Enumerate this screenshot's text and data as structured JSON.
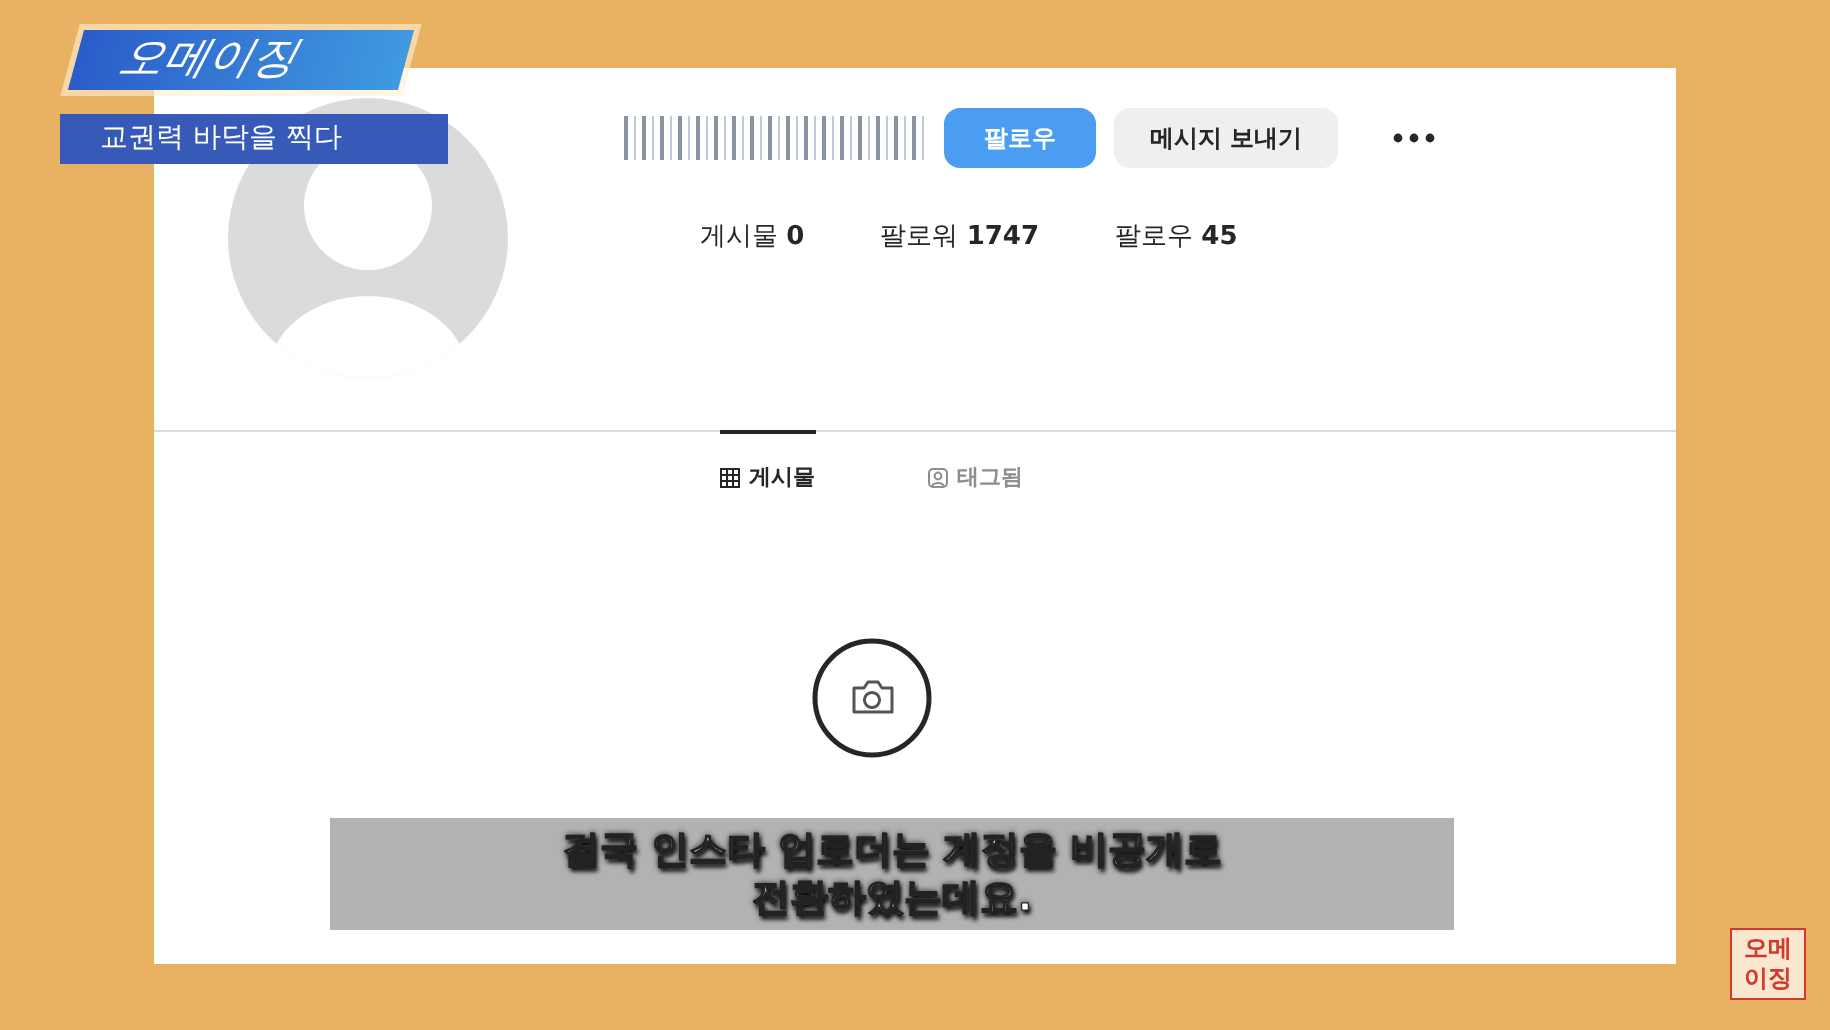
{
  "overlay": {
    "channel_logo": "오메이징",
    "program_title": "교권력 바닥을 찍다"
  },
  "profile": {
    "buttons": [
      {
        "label": "팔로우",
        "kind": "primary"
      },
      {
        "label": "메시지 보내기",
        "kind": "secondary"
      }
    ],
    "stats": [
      {
        "label": "게시물",
        "count": "0"
      },
      {
        "label": "팔로워",
        "count": "1747"
      },
      {
        "label": "팔로우",
        "count": "45"
      }
    ]
  },
  "tabs": [
    {
      "label": "게시물",
      "selected": true
    },
    {
      "label": "태그됨",
      "selected": false
    }
  ],
  "subtitle": [
    "결국 인스타 업로더는 계정을 비공개로",
    "전환하였는데요."
  ],
  "corner_logo": [
    "오메",
    "이징"
  ]
}
